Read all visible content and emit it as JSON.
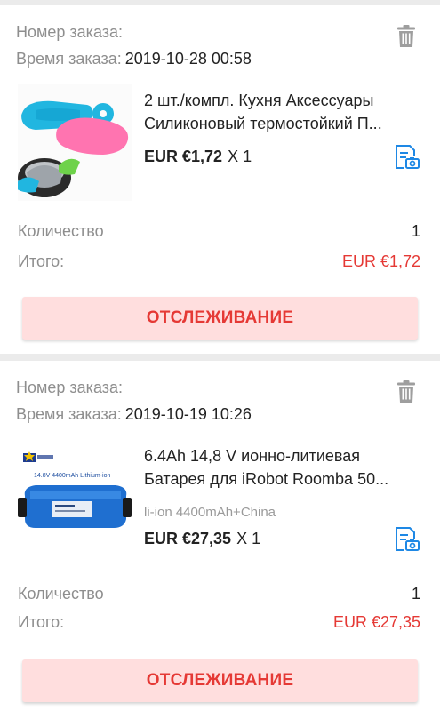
{
  "orders": [
    {
      "number_label": "Номер заказа:",
      "number_value": "",
      "time_label": "Время заказа:",
      "time_value": "2019-10-28 00:58",
      "title_line1": "2 шт./компл. Кухня Аксессуары",
      "title_line2": "Силиконовый термостойкий П...",
      "variant": "",
      "price": "EUR €1,72",
      "multiplier": "X 1",
      "quantity_label": "Количество",
      "quantity_value": "1",
      "total_label": "Итого:",
      "total_value": "EUR €1,72",
      "track_label": "ОТСЛЕЖИВАНИЕ"
    },
    {
      "number_label": "Номер заказа:",
      "number_value": "",
      "time_label": "Время заказа:",
      "time_value": "2019-10-19 10:26",
      "title_line1": "6.4Ah 14,8 V ионно-литиевая",
      "title_line2": "Батарея для iRobot Roomba 50...",
      "variant": "li-ion 4400mAh+China",
      "price": "EUR €27,35",
      "multiplier": "X 1",
      "quantity_label": "Количество",
      "quantity_value": "1",
      "total_label": "Итого:",
      "total_value": "EUR €27,35",
      "track_label": "ОТСЛЕЖИВАНИЕ",
      "battery_label": "14.8V 4400mAh Lithium-ion"
    }
  ],
  "colors": {
    "accent": "#e53935",
    "button_bg": "#ffdede",
    "icon_blue": "#1e88e5",
    "muted": "#8e8e8e"
  }
}
